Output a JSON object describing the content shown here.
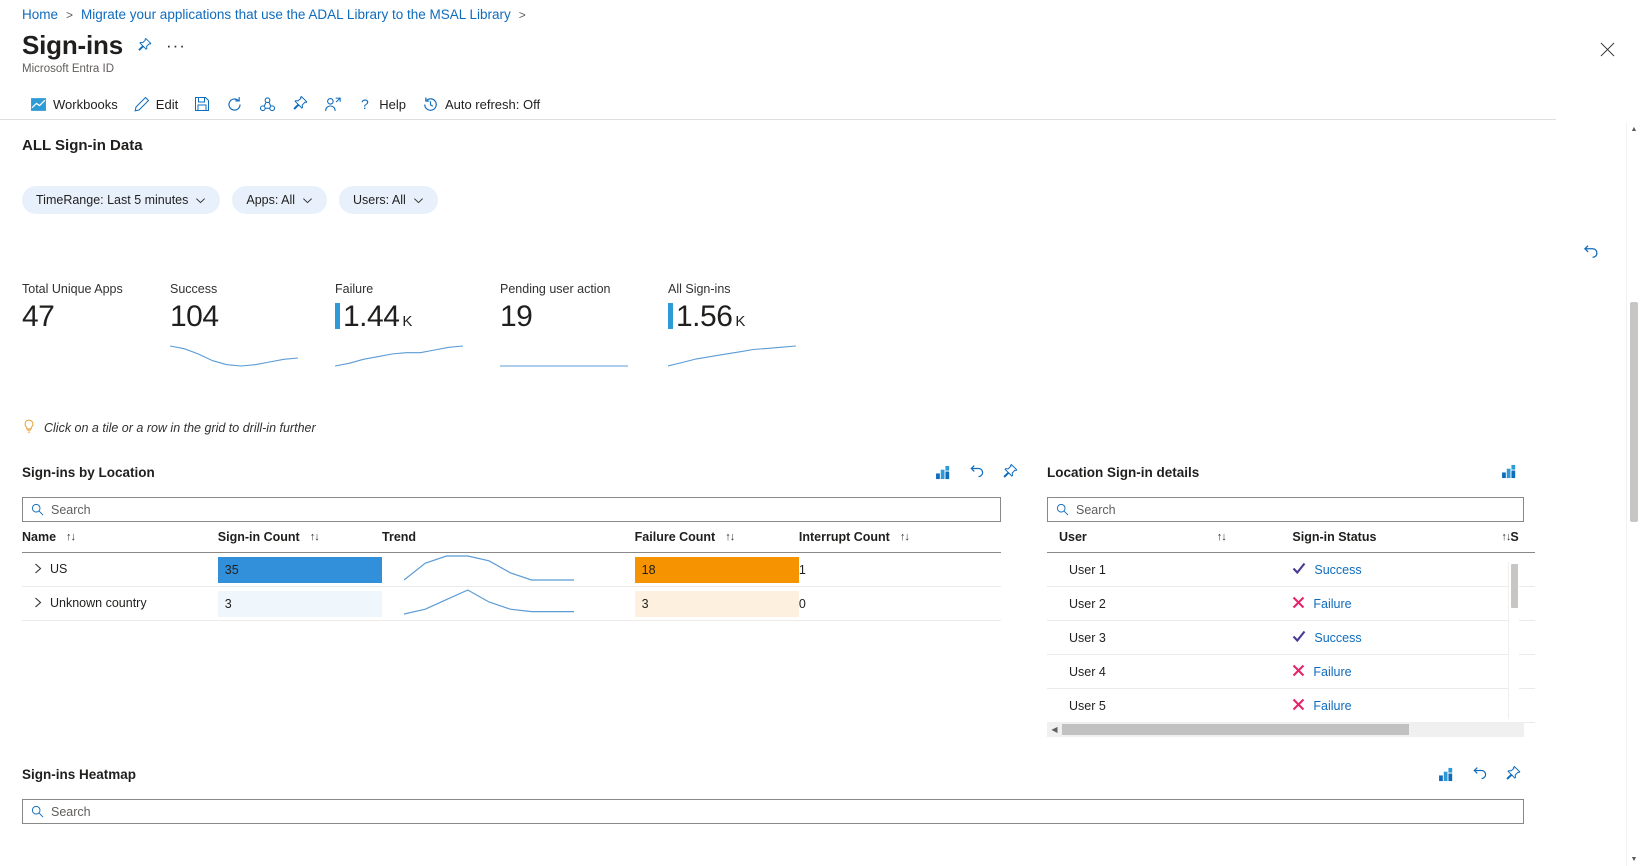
{
  "breadcrumb": {
    "items": [
      {
        "label": "Home"
      },
      {
        "label": "Migrate your applications that use the ADAL Library to the MSAL Library"
      }
    ],
    "separator": ">"
  },
  "header": {
    "title": "Sign-ins",
    "subtitle": "Microsoft Entra ID",
    "pin_icon": "pin-icon",
    "more_icon": "ellipsis-icon",
    "close_icon": "close-icon"
  },
  "toolbar": {
    "items": [
      {
        "label": "Workbooks",
        "icon": "workbooks-icon"
      },
      {
        "label": "Edit",
        "icon": "pencil-icon"
      },
      {
        "label": "",
        "icon": "save-icon"
      },
      {
        "label": "",
        "icon": "refresh-icon"
      },
      {
        "label": "",
        "icon": "share-icon"
      },
      {
        "label": "",
        "icon": "pin-icon"
      },
      {
        "label": "",
        "icon": "assign-user-icon"
      },
      {
        "label": "Help",
        "icon": "question-icon"
      },
      {
        "label": "Auto refresh: Off",
        "icon": "clock-history-icon"
      }
    ]
  },
  "content": {
    "section_title": "ALL Sign-in Data",
    "filters": [
      {
        "label": "TimeRange: Last 5 minutes"
      },
      {
        "label": "Apps: All"
      },
      {
        "label": "Users: All"
      }
    ],
    "refresh_icon": "undo-refresh-icon",
    "hint": "Click on a tile or a row in the grid to drill-in further",
    "hint_icon": "lightbulb-icon"
  },
  "tiles": [
    {
      "label": "Total Unique Apps",
      "value": "47",
      "unit": "",
      "bar": false,
      "spark": []
    },
    {
      "label": "Success",
      "value": "104",
      "unit": "",
      "bar": false,
      "spark": [
        28,
        26,
        22,
        17,
        14,
        13,
        14,
        16,
        18,
        19
      ]
    },
    {
      "label": "Failure",
      "value": "1.44",
      "unit": "K",
      "bar": true,
      "spark": [
        10,
        12,
        15,
        17,
        19,
        20,
        20,
        22,
        24,
        25
      ]
    },
    {
      "label": "Pending user action",
      "value": "19",
      "unit": "",
      "bar": false,
      "spark": [
        22,
        22,
        22,
        22,
        22,
        22,
        22,
        22,
        22,
        22
      ]
    },
    {
      "label": "All Sign-ins",
      "value": "1.56",
      "unit": "K",
      "bar": true,
      "spark": [
        8,
        11,
        14,
        16,
        18,
        20,
        22,
        23,
        24,
        25
      ]
    }
  ],
  "location_grid": {
    "title": "Sign-ins by Location",
    "icons": [
      "chart-icon",
      "undo-icon",
      "pin-icon"
    ],
    "search_placeholder": "Search",
    "columns": [
      "Name",
      "Sign-in Count",
      "Trend",
      "Failure Count",
      "Interrupt Count"
    ],
    "sortable": [
      true,
      true,
      false,
      true,
      true
    ],
    "rows": [
      {
        "name": "US",
        "signin_count": "35",
        "signin_pct": 100,
        "failure_count": "18",
        "failure_pct": 100,
        "interrupt_count": "1",
        "trend": [
          6,
          20,
          26,
          26,
          22,
          12,
          6,
          6,
          6
        ]
      },
      {
        "name": "Unknown country",
        "signin_count": "3",
        "signin_pct": 100,
        "failure_count": "3",
        "failure_pct": 100,
        "interrupt_count": "0",
        "trend": [
          4,
          6,
          10,
          14,
          9,
          6,
          5,
          5,
          5
        ]
      }
    ]
  },
  "details_grid": {
    "title": "Location Sign-in details",
    "icons": [
      "chart-icon"
    ],
    "search_placeholder": "Search",
    "columns": [
      "User",
      "Sign-in Status",
      "S"
    ],
    "rows": [
      {
        "user": "User 1",
        "status": "Success",
        "status_icon": "check-icon"
      },
      {
        "user": "User 2",
        "status": "Failure",
        "status_icon": "cross-icon"
      },
      {
        "user": "User 3",
        "status": "Success",
        "status_icon": "check-icon"
      },
      {
        "user": "User 4",
        "status": "Failure",
        "status_icon": "cross-icon"
      },
      {
        "user": "User 5",
        "status": "Failure",
        "status_icon": "cross-icon"
      }
    ]
  },
  "heatmap": {
    "title": "Sign-ins Heatmap",
    "icons": [
      "chart-icon",
      "undo-icon",
      "pin-icon"
    ],
    "search_placeholder": "Search"
  },
  "colors": {
    "link": "#0f6cbd",
    "bar_blue": "#3190d9",
    "bar_orange": "#f59300",
    "bar_blue_faint": "#eff6fc",
    "bar_orange_faint": "#fdf0de",
    "success": "#4a3a91",
    "failure": "#e3256b",
    "pill_bg": "#e8f1fb"
  }
}
